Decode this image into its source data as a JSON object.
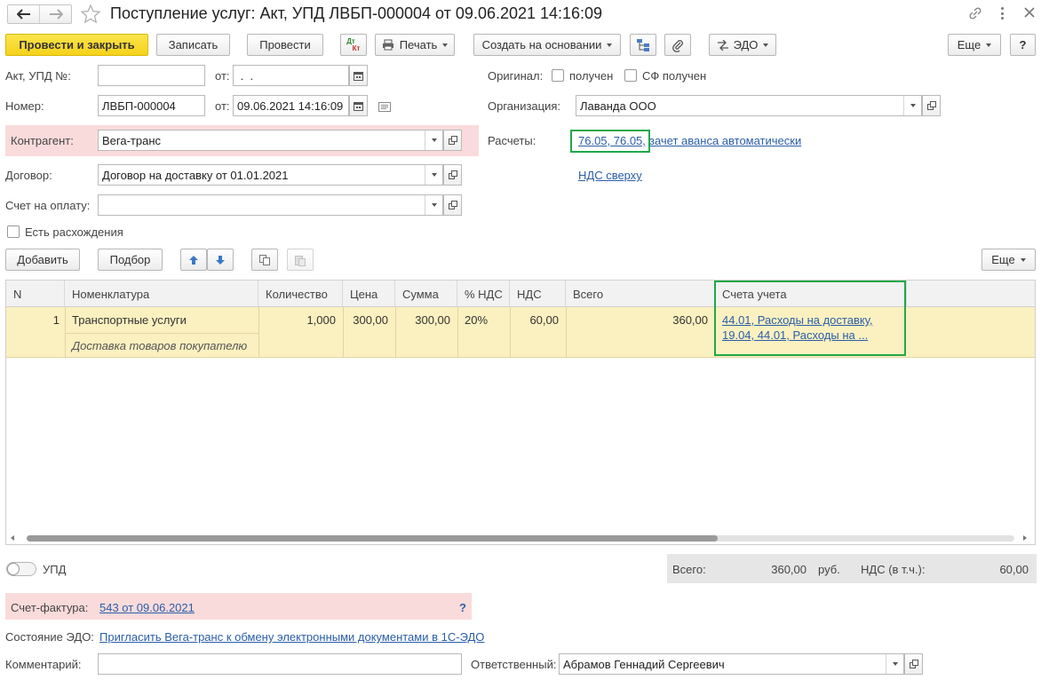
{
  "window": {
    "title": "Поступление услуг: Акт, УПД ЛВБП-000004 от 09.06.2021 14:16:09"
  },
  "toolbar": {
    "post_close": "Провести и закрыть",
    "save": "Записать",
    "post": "Провести",
    "dtkt_top": "Дт",
    "dtkt_bottom": "Кт",
    "print": "Печать",
    "create_based": "Создать на основании",
    "edo": "ЭДО",
    "more": "Еще",
    "help": "?"
  },
  "header": {
    "act_label": "Акт, УПД №:",
    "act_value": "",
    "from_label": "от:",
    "act_date_value": " .  .",
    "number_label": "Номер:",
    "number_value": "ЛВБП-000004",
    "number_date_value": "09.06.2021 14:16:09",
    "original_label": "Оригинал:",
    "received_label": "получен",
    "sf_received_label": "СФ получен",
    "org_label": "Организация:",
    "org_value": "Лаванда ООО",
    "counterparty_label": "Контрагент:",
    "counterparty_value": "Вега-транс",
    "settlements_label": "Расчеты:",
    "settlements_link_part1": "76.05, 76.05,",
    "settlements_link_part2": "зачет аванса автоматически",
    "contract_label": "Договор:",
    "contract_value": "Договор на доставку от 01.01.2021",
    "vat_link": "НДС сверху",
    "invoice_label": "Счет на оплату:",
    "invoice_value": "",
    "discrepancy_label": "Есть расхождения"
  },
  "table_toolbar": {
    "add": "Добавить",
    "pick": "Подбор",
    "more": "Еще"
  },
  "table": {
    "columns": [
      "N",
      "Номенклатура",
      "Количество",
      "Цена",
      "Сумма",
      "% НДС",
      "НДС",
      "Всего",
      "Счета учета"
    ],
    "rows": [
      {
        "n": "1",
        "item": "Транспортные услуги",
        "item_desc": "Доставка товаров покупателю",
        "qty": "1,000",
        "price": "300,00",
        "sum": "300,00",
        "vat_rate": "20%",
        "vat": "60,00",
        "total": "360,00",
        "accounts_line1": "44.01, Расходы на доставку,",
        "accounts_line2": "19.04, 44.01, Расходы на ..."
      }
    ]
  },
  "footer": {
    "upd_label": "УПД",
    "total_label": "Всего:",
    "total_value": "360,00",
    "currency": "руб.",
    "vat_incl_label": "НДС (в т.ч.):",
    "vat_incl_value": "60,00",
    "invoice_label": "Счет-фактура:",
    "invoice_link": "543 от 09.06.2021",
    "invoice_help": "?",
    "edo_state_label": "Состояние ЭДО:",
    "edo_state_link": "Пригласить Вега-транс к обмену электронными документами в 1С-ЭДО",
    "comment_label": "Комментарий:",
    "comment_value": "",
    "responsible_label": "Ответственный:",
    "responsible_value": "Абрамов Геннадий Сергеевич"
  },
  "colors": {
    "accent_yellow": "#f5d21a",
    "row_highlight": "#fbf0c0",
    "error_pink": "#fadbdb",
    "link_blue": "#2a5ea8",
    "green_highlight": "#1fa84a"
  }
}
